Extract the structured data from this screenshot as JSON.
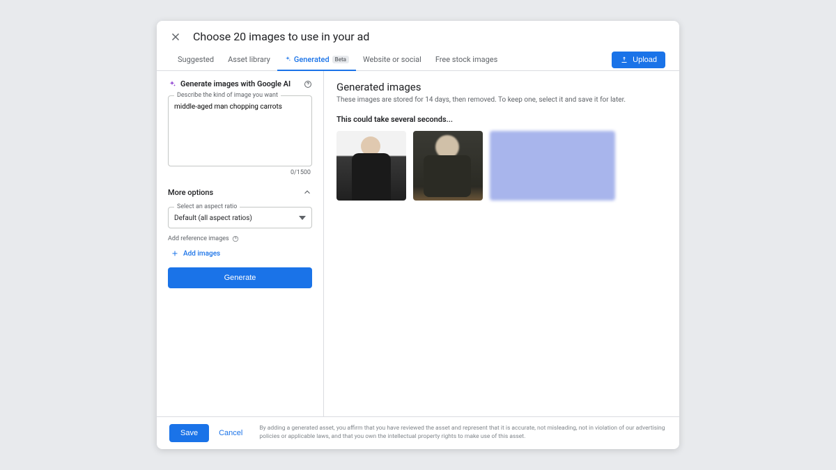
{
  "header": {
    "title": "Choose 20 images to use in your ad"
  },
  "tabs": {
    "suggested": "Suggested",
    "asset_library": "Asset library",
    "generated": "Generated",
    "beta": "Beta",
    "website": "Website or social",
    "stock": "Free stock images"
  },
  "upload": {
    "label": "Upload"
  },
  "ai": {
    "title": "Generate images with Google AI",
    "prompt_label": "Describe the kind of image you want",
    "prompt_value": "middle-aged man chopping carrots",
    "char_count": "0/1500"
  },
  "more_options": {
    "label": "More options"
  },
  "aspect": {
    "label": "Select an aspect ratio",
    "value": "Default (all aspect ratios)"
  },
  "reference": {
    "label": "Add reference images",
    "add_label": "Add images"
  },
  "generate": {
    "label": "Generate"
  },
  "results": {
    "title": "Generated images",
    "subtitle": "These images are stored for 14 days, then removed. To keep one, select it and save it for later.",
    "loading": "This could take several seconds..."
  },
  "footer": {
    "save": "Save",
    "cancel": "Cancel",
    "disclaimer": "By adding a generated asset, you affirm that you have reviewed the asset and represent that it is accurate, not misleading, not in violation of our advertising policies or applicable laws, and that you own the intellectual property rights to make use of this asset."
  }
}
